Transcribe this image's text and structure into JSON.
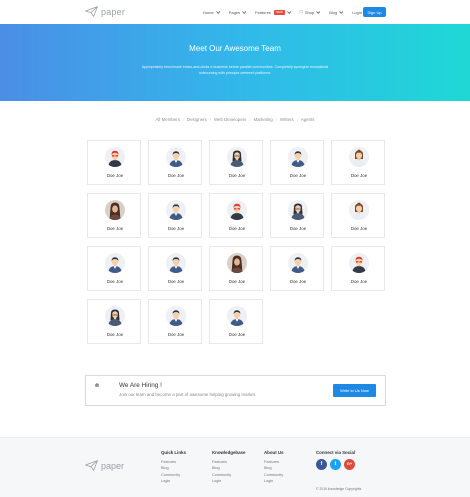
{
  "brand": {
    "logo_text": "paper"
  },
  "nav": {
    "items": [
      {
        "label": "Home",
        "dropdown": true
      },
      {
        "label": "Pages",
        "dropdown": true
      },
      {
        "label": "Features",
        "badge": "NEW",
        "dropdown": true
      },
      {
        "label": "Shop",
        "dropdown": true,
        "icon": "cart-icon"
      },
      {
        "label": "Blog",
        "dropdown": true
      },
      {
        "label": "Login",
        "dropdown": false
      }
    ],
    "signup_label": "Sign Up"
  },
  "hero": {
    "title": "Meet Our Awesome Team",
    "text": "Appropriately benchmark bricks-and-clicks e-business before parallel communities. Completely synergize exceptional outsourcing with principle-centered platforms."
  },
  "filters": [
    "All Members",
    "Designers",
    "Web Developers",
    "Marketing",
    "Writers",
    "Agents"
  ],
  "team": {
    "members": [
      {
        "name": "Doe Joe",
        "avatar": "red-hair-glasses"
      },
      {
        "name": "Doe Joe",
        "avatar": "man-blue-shirt"
      },
      {
        "name": "Doe Joe",
        "avatar": "woman-dark-hair"
      },
      {
        "name": "Doe Joe",
        "avatar": "man-blue-shirt"
      },
      {
        "name": "Doe Joe",
        "avatar": "woman-brown-hair"
      },
      {
        "name": "Doe Joe",
        "avatar": "woman-photo"
      },
      {
        "name": "Doe Joe",
        "avatar": "man-blue-shirt"
      },
      {
        "name": "Doe Joe",
        "avatar": "red-hair-glasses"
      },
      {
        "name": "Doe Joe",
        "avatar": "woman-dark-hair"
      },
      {
        "name": "Doe Joe",
        "avatar": "woman-brown-hair"
      },
      {
        "name": "Doe Joe",
        "avatar": "man-blue-shirt"
      },
      {
        "name": "Doe Joe",
        "avatar": "man-blue-shirt"
      },
      {
        "name": "Doe Joe",
        "avatar": "woman-photo"
      },
      {
        "name": "Doe Joe",
        "avatar": "man-blue-shirt"
      },
      {
        "name": "Doe Joe",
        "avatar": "red-hair-glasses"
      },
      {
        "name": "Doe Joe",
        "avatar": "woman-dark-hair"
      },
      {
        "name": "Doe Joe",
        "avatar": "man-blue-shirt"
      },
      {
        "name": "Doe Joe",
        "avatar": "man-blue-shirt"
      }
    ]
  },
  "hiring": {
    "title": "We Are Hiring !",
    "text": "Join our team and become a part of awesome helping growing market.",
    "button_label": "Write to Us Now"
  },
  "footer": {
    "logo_text": "paper",
    "columns": [
      {
        "title": "Quick Links",
        "links": [
          "Features",
          "Blog",
          "Community",
          "Login"
        ]
      },
      {
        "title": "Knowledgebase",
        "links": [
          "Features",
          "Blog",
          "Community",
          "Login"
        ]
      },
      {
        "title": "About Us",
        "links": [
          "Features",
          "Blog",
          "Community",
          "Login"
        ]
      }
    ],
    "social_title": "Connect via Social",
    "social": [
      {
        "name": "facebook-icon",
        "glyph": "f",
        "color": "#3b5998"
      },
      {
        "name": "twitter-icon",
        "glyph": "t",
        "color": "#1da1f2"
      },
      {
        "name": "google-plus-icon",
        "glyph": "G+",
        "color": "#dd4b39"
      }
    ],
    "copyright": "© 2016 knowledge Copyrights"
  },
  "colors": {
    "accent": "#1e88e5",
    "hero_start": "#4b8ee6",
    "hero_end": "#1fd8d6"
  }
}
